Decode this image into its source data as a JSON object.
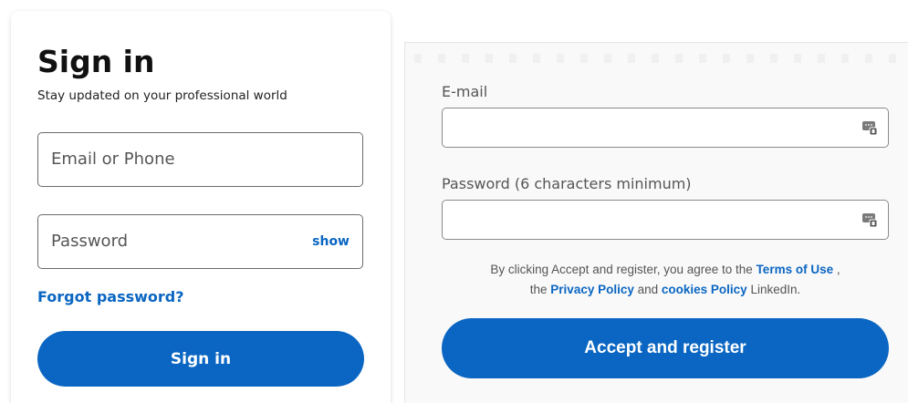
{
  "signin": {
    "title": "Sign in",
    "subtitle": "Stay updated on your professional world",
    "email_placeholder": "Email or Phone",
    "password_placeholder": "Password",
    "show_label": "show",
    "forgot_label": "Forgot password?",
    "button_label": "Sign in"
  },
  "register": {
    "email_label": "E-mail",
    "password_label": "Password (6 characters minimum)",
    "field_icon": "password-manager-key-icon",
    "terms": {
      "prefix": "By clicking Accept and register, you agree to the ",
      "terms_link": "Terms of Use",
      "after_terms": " ,",
      "line2_prefix": "the ",
      "privacy_link": "Privacy Policy",
      "and": " and ",
      "cookies_link": "cookies Policy",
      "suffix": " LinkedIn."
    },
    "button_label": "Accept and register"
  },
  "colors": {
    "accent": "#0a66c2",
    "text_dark": "#111111",
    "text_muted": "#555555",
    "panel_bg": "#f9f9f9"
  }
}
